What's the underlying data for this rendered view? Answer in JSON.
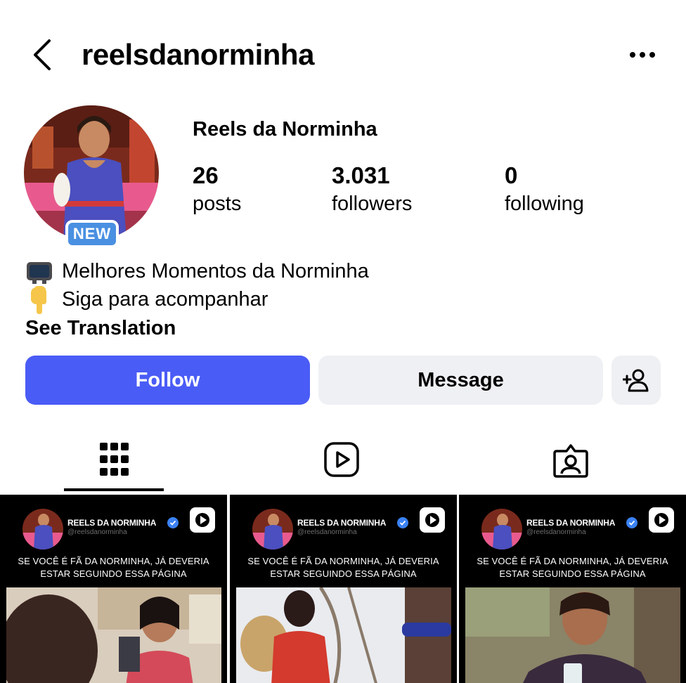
{
  "header": {
    "username": "reelsdanorminha",
    "back_icon": "chevron-left-icon",
    "more_icon": "more-horizontal-icon"
  },
  "profile": {
    "display_name": "Reels da Norminha",
    "badge": "NEW",
    "stats": [
      {
        "value": "26",
        "label": "posts"
      },
      {
        "value": "3.031",
        "label": "followers"
      },
      {
        "value": "0",
        "label": "following"
      }
    ],
    "bio": [
      {
        "emoji": "television-emoji",
        "text": "Melhores Momentos da Norminha"
      },
      {
        "emoji": "pointing-down-emoji",
        "text": "Siga para acompanhar"
      }
    ],
    "see_translation": "See Translation"
  },
  "actions": {
    "follow_label": "Follow",
    "message_label": "Message",
    "add_user_icon": "add-person-icon"
  },
  "tabs": [
    {
      "name": "grid-icon",
      "active": true
    },
    {
      "name": "reels-icon",
      "active": false
    },
    {
      "name": "tagged-icon",
      "active": false
    }
  ],
  "posts": [
    {
      "account_name": "REELS DA NORMINHA",
      "handle": "@reelsdanorminha",
      "caption_line1": "SE VOCÊ É FÃ DA NORMINHA, JÁ DEVERIA",
      "caption_line2": "ESTAR SEGUINDO ESSA PÁGINA"
    },
    {
      "account_name": "REELS DA NORMINHA",
      "handle": "@reelsdanorminha",
      "caption_line1": "SE VOCÊ É FÃ DA NORMINHA, JÁ DEVERIA",
      "caption_line2": "ESTAR SEGUINDO ESSA PÁGINA"
    },
    {
      "account_name": "REELS DA NORMINHA",
      "handle": "@reelsdanorminha",
      "caption_line1": "SE VOCÊ É FÃ DA NORMINHA, JÁ DEVERIA",
      "caption_line2": "ESTAR SEGUINDO ESSA PÁGINA"
    }
  ],
  "colors": {
    "follow_button": "#4a5cf6",
    "secondary_button": "#eff0f4",
    "badge": "#4a90e2",
    "verified": "#3b82f6"
  }
}
